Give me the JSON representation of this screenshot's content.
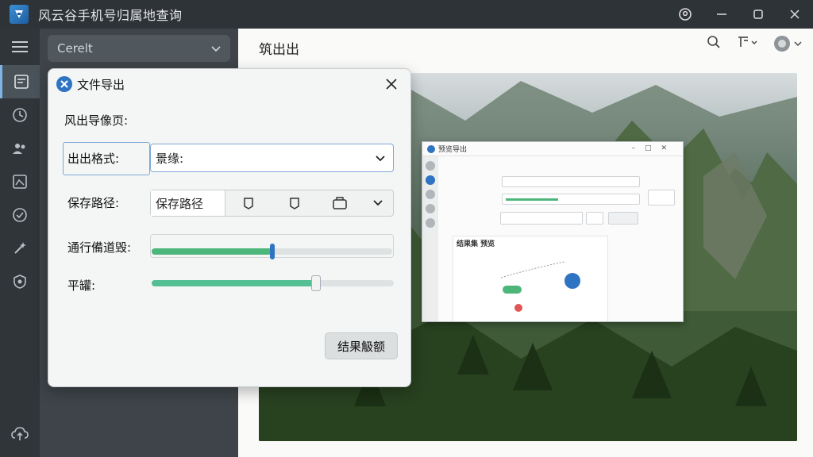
{
  "app": {
    "title": "风云谷手机号归属地查询",
    "colors": {
      "titlebar": "#2e3338",
      "sidebar": "#30353a",
      "panel": "#3e4449",
      "accent": "#2f74c2",
      "slider_green": "#4db67a"
    }
  },
  "titlebar_icons": [
    "location-pin-icon",
    "minimize-icon",
    "maximize-icon",
    "close-icon"
  ],
  "sidebar": {
    "menu_icon": "menu-icon",
    "items": [
      {
        "icon": "document-icon",
        "active": true
      },
      {
        "icon": "clock-icon",
        "active": false
      },
      {
        "icon": "users-icon",
        "active": false
      },
      {
        "icon": "image-icon",
        "active": false
      },
      {
        "icon": "check-circle-icon",
        "active": false
      },
      {
        "icon": "wand-icon",
        "active": false
      },
      {
        "icon": "shield-icon",
        "active": false
      }
    ],
    "bottom_icon": "cloud-upload-icon"
  },
  "panel": {
    "dropdown_value": "Cerelt"
  },
  "main": {
    "header": "筑出出",
    "tools": [
      "search-icon",
      "sort-icon",
      "profile-icon"
    ]
  },
  "dialog": {
    "title": "文件导出",
    "section": "风出导像页:",
    "format_label": "出出格式:",
    "format_value": "景缘:",
    "path_label": "保存路径:",
    "path_value": "保存路径",
    "quality_label": "通行備道毁:",
    "quality_value": 0.5,
    "level_label": "平罐:",
    "level_value": 0.68,
    "result_button": "结果觙额"
  },
  "mini_window": {
    "title": "预览导出",
    "panel_title": "结果集 预览"
  }
}
